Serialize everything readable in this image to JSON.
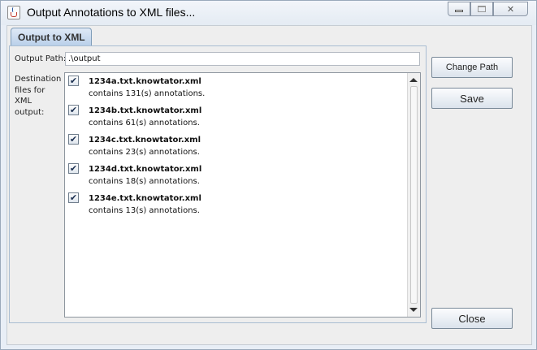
{
  "window": {
    "title": "Output Annotations to XML files...",
    "icon": "java-cup-icon"
  },
  "tab": {
    "label": "Output to XML"
  },
  "form": {
    "output_path_label": "Output Path:",
    "output_path_value": ".\\output",
    "destination_label": "Destination files for XML output:"
  },
  "files": [
    {
      "name": "1234a.txt.knowtator.xml",
      "description": "contains 131(s) annotations.",
      "checked": true
    },
    {
      "name": "1234b.txt.knowtator.xml",
      "description": "contains 61(s) annotations.",
      "checked": true
    },
    {
      "name": "1234c.txt.knowtator.xml",
      "description": "contains 23(s) annotations.",
      "checked": true
    },
    {
      "name": "1234d.txt.knowtator.xml",
      "description": "contains 18(s) annotations.",
      "checked": true
    },
    {
      "name": "1234e.txt.knowtator.xml",
      "description": "contains 13(s) annotations.",
      "checked": true
    }
  ],
  "buttons": {
    "change_path": "Change Path",
    "save": "Save",
    "close": "Close"
  },
  "checkmark": "✔"
}
